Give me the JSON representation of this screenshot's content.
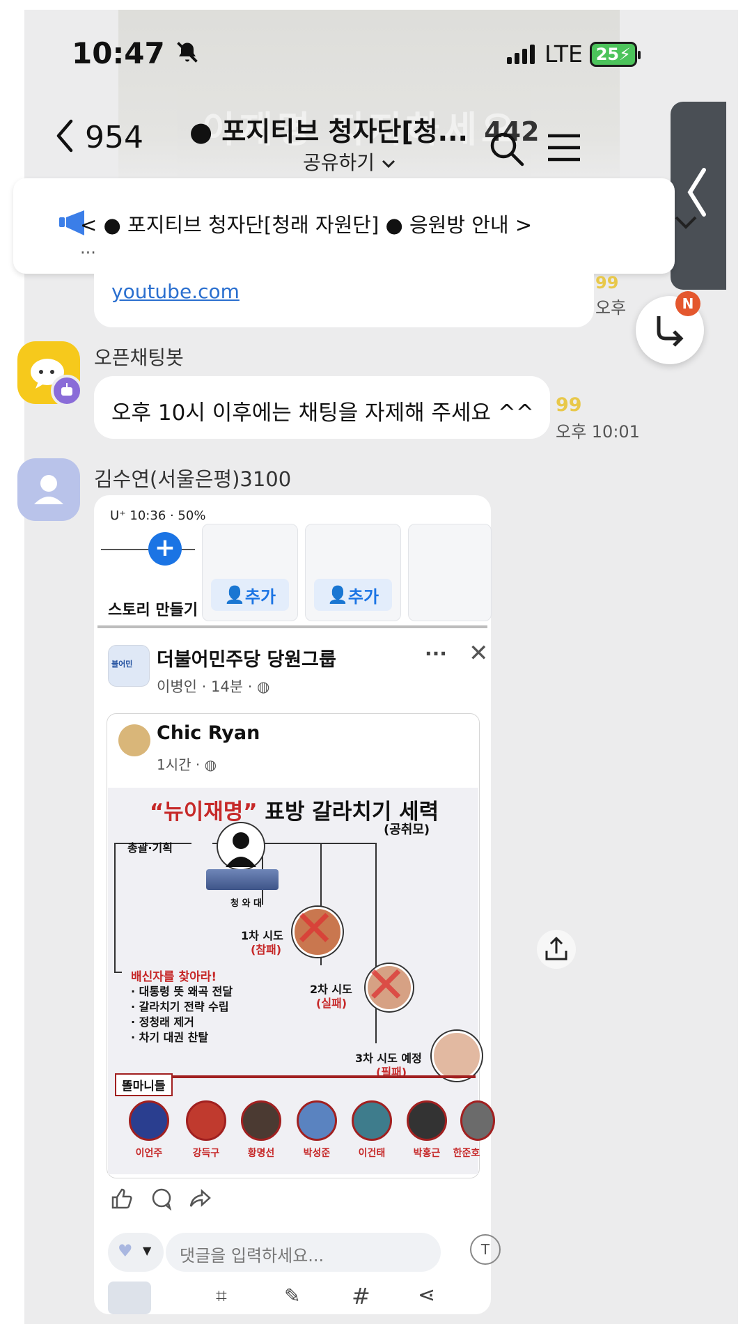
{
  "status_bar": {
    "time": "10:47",
    "network": "LTE",
    "battery": "25"
  },
  "header": {
    "back_count": "954",
    "room_title": "● 포지티브 청자단[청...",
    "member_count": "442",
    "share_label": "공유하기"
  },
  "notice": {
    "text": "< ● 포지티브 청자단[청래 자원단] ● 응원방 안내 >",
    "more": "..."
  },
  "previous_message": {
    "link": "youtube.com",
    "unread": "99",
    "time": "오후 "
  },
  "fwd_badge": "N",
  "bot_message": {
    "sender": "오픈채팅봇",
    "text": "오후 10시 이후에는 채팅을 자제해 주세요 ^^",
    "unread": "99",
    "time": "오후 10:01"
  },
  "user_message": {
    "sender": "김수연(서울은평)3100"
  },
  "shared_screenshot": {
    "status": "U⁺ 10:36  ·   50%",
    "stories": {
      "create_label": "스토리 만들기",
      "add_label_1": "추가",
      "add_label_2": "추가"
    },
    "group": {
      "name": "더불어민주당 당원그룹",
      "meta": "이병인 · 14분 ·",
      "logo_text": "블어민"
    },
    "post": {
      "author": "Chic Ryan",
      "meta": "1시간 ·"
    },
    "graphic": {
      "title_quote": "“뉴이재명”",
      "title_rest": " 표방 갈라치기 세력",
      "source": "(공취모)",
      "plan_label": "총괄·기획",
      "office_label": "청 와 대",
      "try1": "1차 시도",
      "try1_result": "(참패)",
      "try2": "2차 시도",
      "try2_result": "(실패)",
      "try3": "3차 시도 예정",
      "try3_result": "(필패)",
      "betray_label": "배신자를 찾아라!",
      "bullets": [
        "· 대통령 뜻 왜곡 전달",
        "· 갈라치기 전략 수립",
        "· 정청래 제거",
        "· 차기 대권 찬탈"
      ],
      "group_tag": "똘마니들",
      "members": [
        "이언주",
        "강득구",
        "황명선",
        "박성준",
        "이건태",
        "박홍근",
        "한준호"
      ]
    },
    "comment_placeholder": "댓글을 입력하세요..."
  }
}
